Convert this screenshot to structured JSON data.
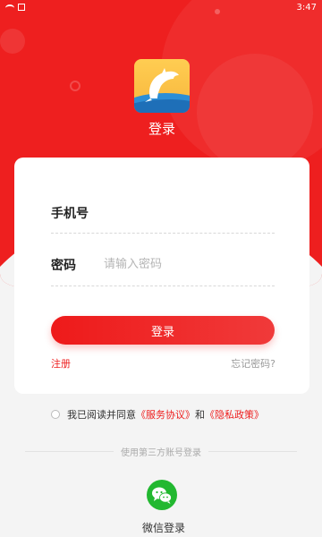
{
  "status_bar": {
    "time": "3:47"
  },
  "app": {
    "title": "登录",
    "logo_icon": "dolphin-logo-icon"
  },
  "form": {
    "phone_label": "手机号",
    "phone_value": "",
    "password_label": "密码",
    "password_placeholder": "请输入密码",
    "login_button": "登录",
    "register_link": "注册",
    "forgot_link": "忘记密码?"
  },
  "agreement": {
    "prefix": "我已阅读并同意",
    "service_link": "《服务协议》",
    "and": "和",
    "privacy_link": "《隐私政策》"
  },
  "third_party": {
    "divider_text": "使用第三方账号登录",
    "wechat_label": "微信登录"
  },
  "colors": {
    "primary": "#ee1f1f",
    "wechat": "#22b830"
  }
}
